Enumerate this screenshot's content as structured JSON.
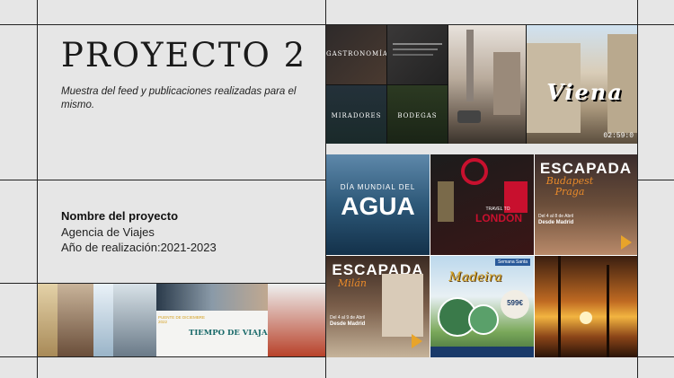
{
  "project": {
    "title": "PROYECTO 2",
    "description": "Muestra del feed y publicaciones realizadas para el mismo.",
    "name_label": "Nombre del proyecto",
    "company": "Agencia de Viajes",
    "year_line": "Año de realización:2021-2023"
  },
  "collage_top": {
    "gastronomia": "GASTRONOMÍA",
    "miradores": "MIRADORES",
    "bodegas": "BODEGAS",
    "viena": "Viena",
    "video_time": "02:59:0"
  },
  "collage_grid": {
    "agua_top": "DÍA MUNDIAL DEL",
    "agua_main": "AGUA",
    "london_travel": "TRAVEL TO",
    "london_city": "LONDON",
    "praga_title": "ESCAPADA",
    "praga_sub": "Budapest Praga",
    "praga_dates": "Del 4 al 8 de Abril",
    "praga_origin": "Desde Madrid",
    "milan_title": "ESCAPADA",
    "milan_sub": "Milán",
    "milan_dates": "Del 4 al 9 de Abril",
    "milan_origin": "Desde Madrid",
    "madeira_badge": "Semana Santa",
    "madeira_title": "Madeira",
    "madeira_price": "599€"
  },
  "collage_bottom": {
    "banner_small": "PUENTE DE DICIEMBRE 2022",
    "banner_main": "TIEMPO DE VIAJAR"
  }
}
